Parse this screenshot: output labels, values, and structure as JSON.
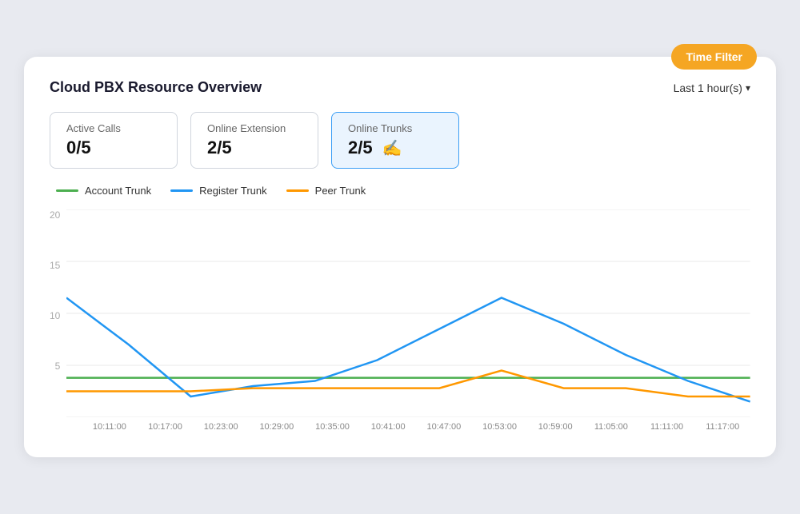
{
  "badge": {
    "label": "Time Filter"
  },
  "header": {
    "title": "Cloud PBX Resource Overview",
    "time_selector_label": "Last 1 hour(s)",
    "chevron": "▾"
  },
  "metrics": [
    {
      "id": "active-calls",
      "label": "Active Calls",
      "value": "0/5",
      "active": false
    },
    {
      "id": "online-extension",
      "label": "Online Extension",
      "value": "2/5",
      "active": false
    },
    {
      "id": "online-trunks",
      "label": "Online Trunks",
      "value": "2/5",
      "active": true
    }
  ],
  "legend": [
    {
      "id": "account-trunk",
      "label": "Account Trunk",
      "color": "#4caf50"
    },
    {
      "id": "register-trunk",
      "label": "Register Trunk",
      "color": "#2196f3"
    },
    {
      "id": "peer-trunk",
      "label": "Peer Trunk",
      "color": "#ff9800"
    }
  ],
  "chart": {
    "y_labels": [
      "20",
      "15",
      "10",
      "5",
      ""
    ],
    "x_labels": [
      "10:11:00",
      "10:17:00",
      "10:23:00",
      "10:29:00",
      "10:35:00",
      "10:41:00",
      "10:47:00",
      "10:53:00",
      "10:59:00",
      "11:05:00",
      "11:11:00",
      "11:17:00"
    ],
    "y_max": 20,
    "account_trunk_data": [
      3.8,
      3.8,
      3.8,
      3.8,
      3.8,
      3.8,
      3.8,
      3.8,
      3.8,
      3.8,
      3.8,
      3.8
    ],
    "register_trunk_data": [
      11.5,
      7.0,
      2.0,
      3.0,
      3.5,
      5.5,
      8.5,
      11.5,
      9.0,
      6.0,
      3.5,
      1.5
    ],
    "peer_trunk_data": [
      2.5,
      2.5,
      2.5,
      2.8,
      2.8,
      2.8,
      2.8,
      4.5,
      2.8,
      2.8,
      2.0,
      2.0
    ]
  }
}
